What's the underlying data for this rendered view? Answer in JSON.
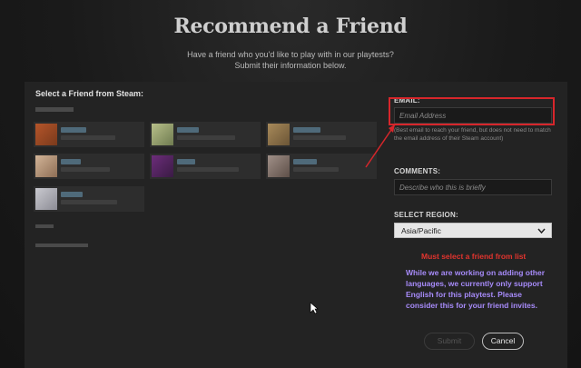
{
  "header": {
    "title": "Recommend a Friend",
    "subtitle_line1": "Have a friend who you'd like to play with in our playtests?",
    "subtitle_line2": "Submit their information below."
  },
  "friends": {
    "heading": "Select a Friend from Steam:",
    "cards": [
      {
        "avatar": "#b5552a",
        "avatar2": "#7a3a1c"
      },
      {
        "avatar": "#b8c08a",
        "avatar2": "#6f7b50"
      },
      {
        "avatar": "#a88a5a",
        "avatar2": "#6b5536"
      },
      {
        "avatar": "#d2b497",
        "avatar2": "#8e6e55"
      },
      {
        "avatar": "#6c2d7a",
        "avatar2": "#3a1b44"
      },
      {
        "avatar": "#a09088",
        "avatar2": "#5e4f48"
      },
      {
        "avatar": "#c9c9cf",
        "avatar2": "#8c8c95"
      }
    ]
  },
  "form": {
    "email_label": "EMAIL:",
    "email_placeholder": "Email Address",
    "email_hint": "(Best email to reach your friend, but does not need to match the email address of their Steam account)",
    "comments_label": "COMMENTS:",
    "comments_placeholder": "Describe who this is briefly",
    "region_label": "SELECT REGION:",
    "region_value": "Asia/Pacific",
    "error": "Must select a friend from list",
    "notice": "While we are working on adding other languages, we currently only support English for this playtest. Please consider this for your friend invites.",
    "submit_label": "Submit",
    "cancel_label": "Cancel"
  },
  "colors": {
    "highlight": "#d7262b",
    "notice": "#a78bfa",
    "error": "#e2342e"
  }
}
